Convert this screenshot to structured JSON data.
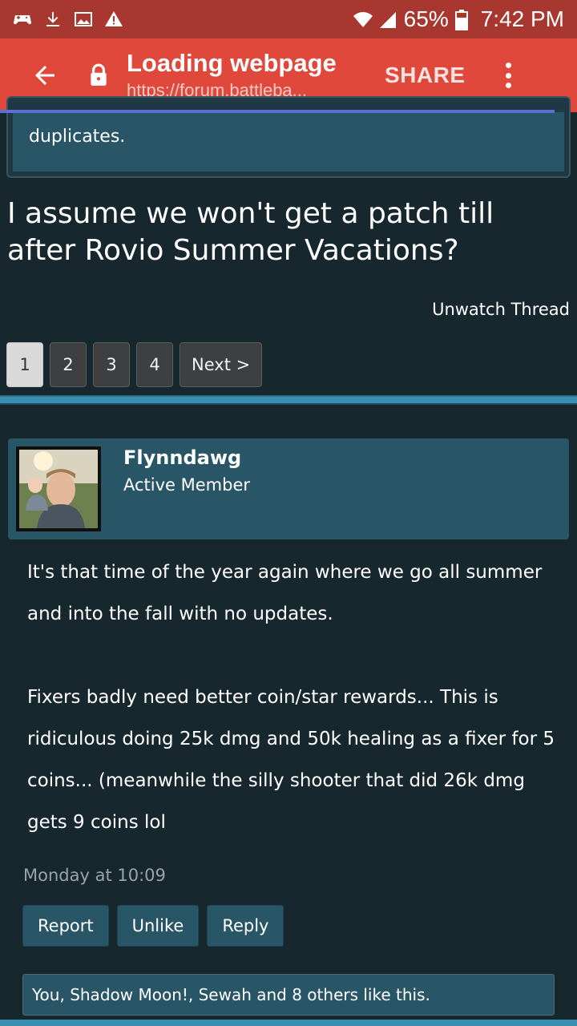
{
  "status_bar": {
    "battery": "65%",
    "time": "7:42 PM",
    "icons": [
      "game-controller-icon",
      "download-icon",
      "image-icon",
      "warning-icon",
      "wifi-icon",
      "signal-icon",
      "battery-icon"
    ]
  },
  "app_bar": {
    "title": "Loading webpage",
    "url": "https://forum.battleba...",
    "share_label": "SHARE",
    "icons": [
      "back-arrow-icon",
      "lock-icon",
      "more-vert-icon"
    ],
    "accent": "#e0483c"
  },
  "quote": {
    "text": "duplicates."
  },
  "thread": {
    "title": "I assume we won't get a patch till after Rovio Summer Vacations?",
    "unwatch_label": "Unwatch Thread"
  },
  "pagination": {
    "pages": [
      "1",
      "2",
      "3",
      "4"
    ],
    "current": "1",
    "next_label": "Next >"
  },
  "post": {
    "author": "Flynndawg",
    "role": "Active Member",
    "paragraphs": [
      "It's that time of the year again where we go all summer and into the fall with no updates.",
      "Fixers badly need better coin/star rewards... This is ridiculous doing 25k dmg and 50k healing as a fixer for 5 coins... (meanwhile the silly shooter that did 26k dmg gets 9 coins lol"
    ],
    "date": "Monday at 10:09",
    "actions": {
      "report": "Report",
      "unlike": "Unlike",
      "reply": "Reply"
    },
    "likes_text": "You, Shadow Moon!, Sewah and 8 others like this."
  }
}
